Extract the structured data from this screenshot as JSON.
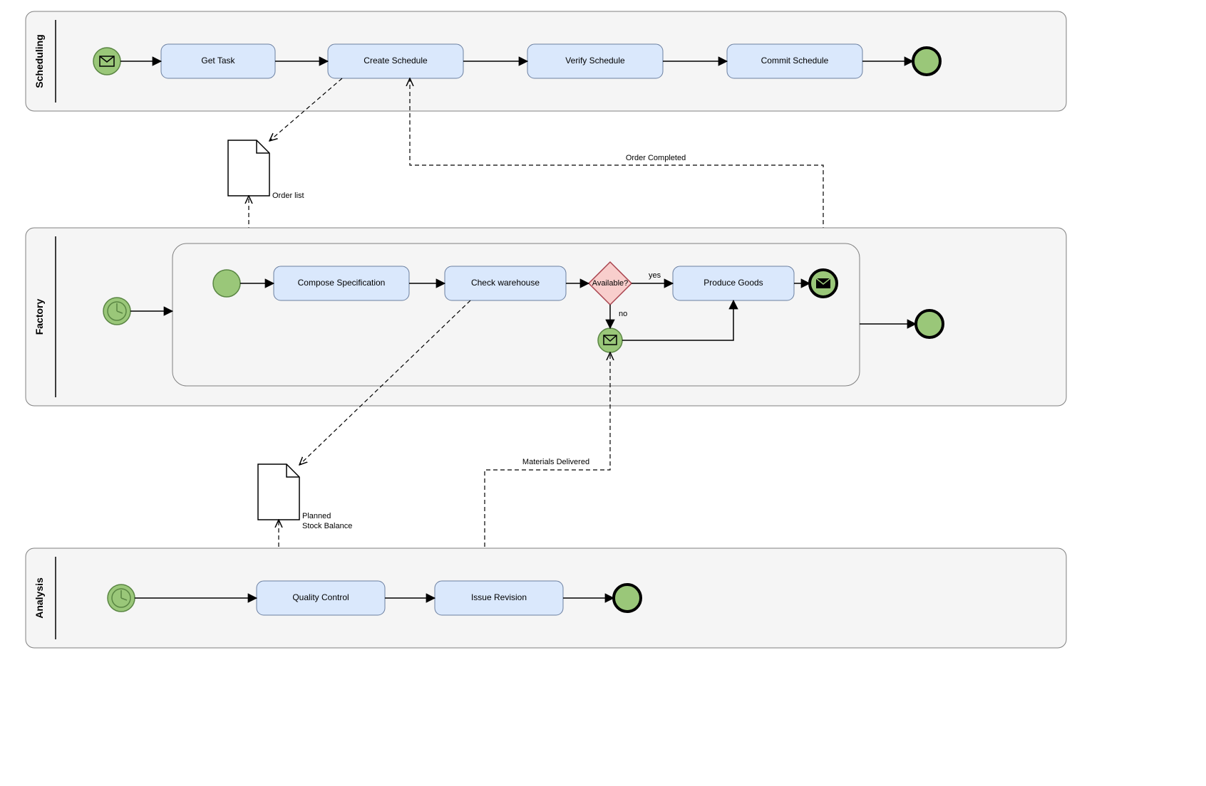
{
  "lanes": {
    "scheduling": "Scheduling",
    "factory": "Factory",
    "analysis": "Analysis"
  },
  "tasks": {
    "get_task": "Get Task",
    "create_schedule": "Create Schedule",
    "verify_schedule": "Verify Schedule",
    "commit_schedule": "Commit Schedule",
    "compose_spec": "Compose Specification",
    "check_warehouse": "Check warehouse",
    "produce_goods": "Produce Goods",
    "quality_control": "Quality Control",
    "issue_revision": "Issue Revision"
  },
  "gateway": {
    "available": "Available?"
  },
  "flow_labels": {
    "yes": "yes",
    "no": "no"
  },
  "messages": {
    "order_completed": "Order Completed",
    "materials_delivered": "Materials Delivered"
  },
  "documents": {
    "order_list": "Order list",
    "planned_stock": "Planned\nStock Balance"
  }
}
